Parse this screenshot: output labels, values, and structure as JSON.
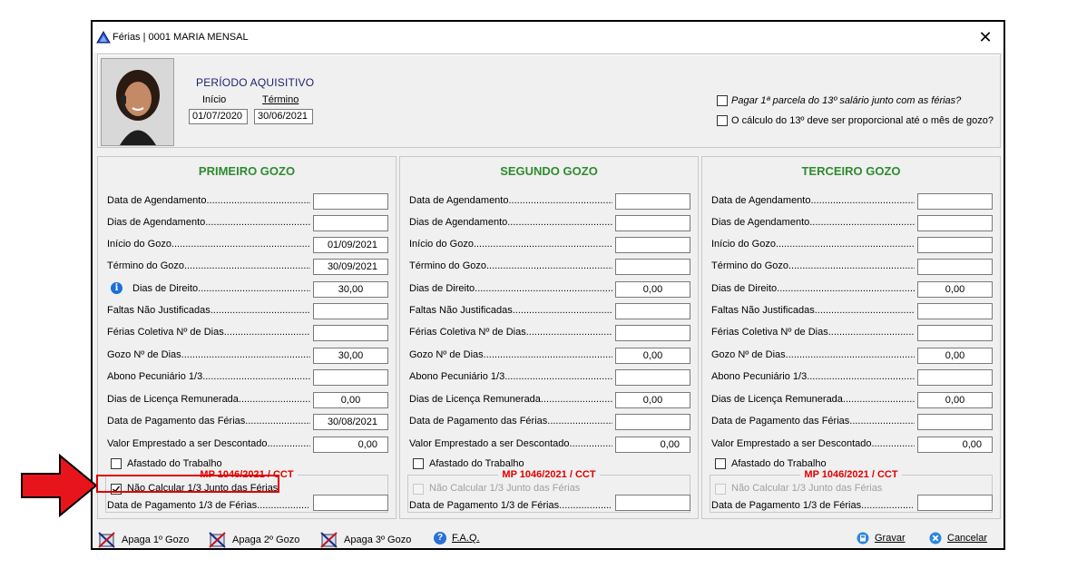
{
  "window": {
    "title": "Férias | 0001 MARIA MENSAL",
    "close_glyph": "✕"
  },
  "header": {
    "periodo_title": "PERÍODO AQUISITIVO",
    "inicio_label": "Início",
    "termino_label": "Término",
    "inicio_value": "01/07/2020",
    "termino_value": "30/06/2021",
    "check1_label": "Pagar 1ª parcela do 13º salário junto com as férias?",
    "check2_label": "O cálculo do 13º deve ser proporcional até o mês de gozo?"
  },
  "labels": {
    "data_agendamento": "Data de Agendamento",
    "dias_agendamento": "Dias de Agendamento",
    "inicio_gozo": "Início do Gozo",
    "termino_gozo": "Término do Gozo",
    "dias_direito": "Dias de Direito",
    "faltas": "Faltas Não Justificadas",
    "ferias_coletiva": "Férias Coletiva Nº de Dias",
    "gozo_dias": "Gozo Nº de Dias",
    "abono": "Abono Pecuniário 1/3",
    "licenca": "Dias de Licença Remunerada",
    "data_pagamento": "Data de Pagamento das Férias",
    "valor_emprestado": "Valor Emprestado a ser Descontado",
    "afastado": "Afastado do Trabalho",
    "mp_title": "MP 1046/2021 / CCT",
    "nao_calcular": "Não Calcular 1/3 Junto das Férias",
    "data_pagamento_13": "Data de Pagamento 1/3 de Férias",
    "info_glyph": "i"
  },
  "columns": [
    {
      "title": "PRIMEIRO GOZO",
      "values": {
        "data_agendamento": "",
        "dias_agendamento": "",
        "inicio_gozo": "01/09/2021",
        "termino_gozo": "30/09/2021",
        "dias_direito": "30,00",
        "faltas": "",
        "ferias_coletiva": "",
        "gozo_dias": "30,00",
        "abono": "",
        "licenca": "0,00",
        "data_pagamento": "30/08/2021",
        "valor_emprestado": "0,00",
        "data_pagamento_13": ""
      }
    },
    {
      "title": "SEGUNDO GOZO",
      "values": {
        "data_agendamento": "",
        "dias_agendamento": "",
        "inicio_gozo": "",
        "termino_gozo": "",
        "dias_direito": "0,00",
        "faltas": "",
        "ferias_coletiva": "",
        "gozo_dias": "0,00",
        "abono": "",
        "licenca": "0,00",
        "data_pagamento": "",
        "valor_emprestado": "0,00",
        "data_pagamento_13": ""
      }
    },
    {
      "title": "TERCEIRO GOZO",
      "values": {
        "data_agendamento": "",
        "dias_agendamento": "",
        "inicio_gozo": "",
        "termino_gozo": "",
        "dias_direito": "0,00",
        "faltas": "",
        "ferias_coletiva": "",
        "gozo_dias": "0,00",
        "abono": "",
        "licenca": "0,00",
        "data_pagamento": "",
        "valor_emprestado": "0,00",
        "data_pagamento_13": ""
      }
    }
  ],
  "toolbar": {
    "apaga1": "Apaga 1º Gozo",
    "apaga2": "Apaga 2º Gozo",
    "apaga3": "Apaga 3º Gozo",
    "faq": "F.A.Q.",
    "gravar": "Gravar",
    "cancelar": "Cancelar",
    "faq_glyph": "?"
  },
  "colors": {
    "accent_green": "#2e8b2e",
    "alert_red": "#e00000",
    "title_navy": "#1f1f6e"
  }
}
